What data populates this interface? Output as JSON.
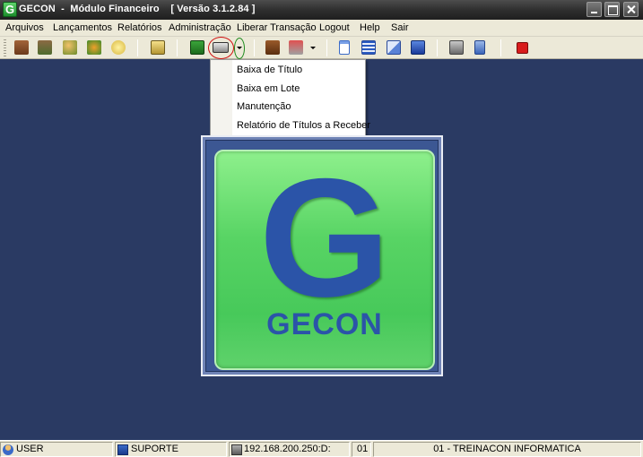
{
  "window": {
    "title": "GECON  -  Módulo Financeiro    [ Versão 3.1.2.84 ]",
    "app_icon_letter": "G"
  },
  "menu": [
    "Arquivos",
    "Lançamentos",
    "Relatórios",
    "Administração",
    "Liberar Transação",
    "Logout",
    "Help",
    "Sair"
  ],
  "toolbar": {
    "icons": [
      "books-icon",
      "folders-icon",
      "person-edit-icon",
      "recycle-icon",
      "coins-icon",
      "calculator-icon",
      "money-icon",
      "check-card-icon",
      "briefcase-icon",
      "stamp-icon",
      "document-icon",
      "list-icon",
      "copy-icon",
      "windows-icon",
      "printer-icon",
      "phone-icon",
      "power-icon"
    ]
  },
  "dropdown": {
    "items": [
      "Baixa de Título",
      "Baixa em Lote",
      "Manutenção",
      "Relatório de Títulos a Receber"
    ]
  },
  "logo": {
    "letter": "G",
    "word": "GECON"
  },
  "statusbar": {
    "user": "USER",
    "department": "SUPORTE",
    "server": "192.168.200.250:D:",
    "company_code": "01",
    "company": "01 - TREINACON INFORMATICA"
  },
  "colors": {
    "desktop": "#2a3a63",
    "logo_green": "#58d464",
    "logo_blue": "#2b54a8"
  }
}
